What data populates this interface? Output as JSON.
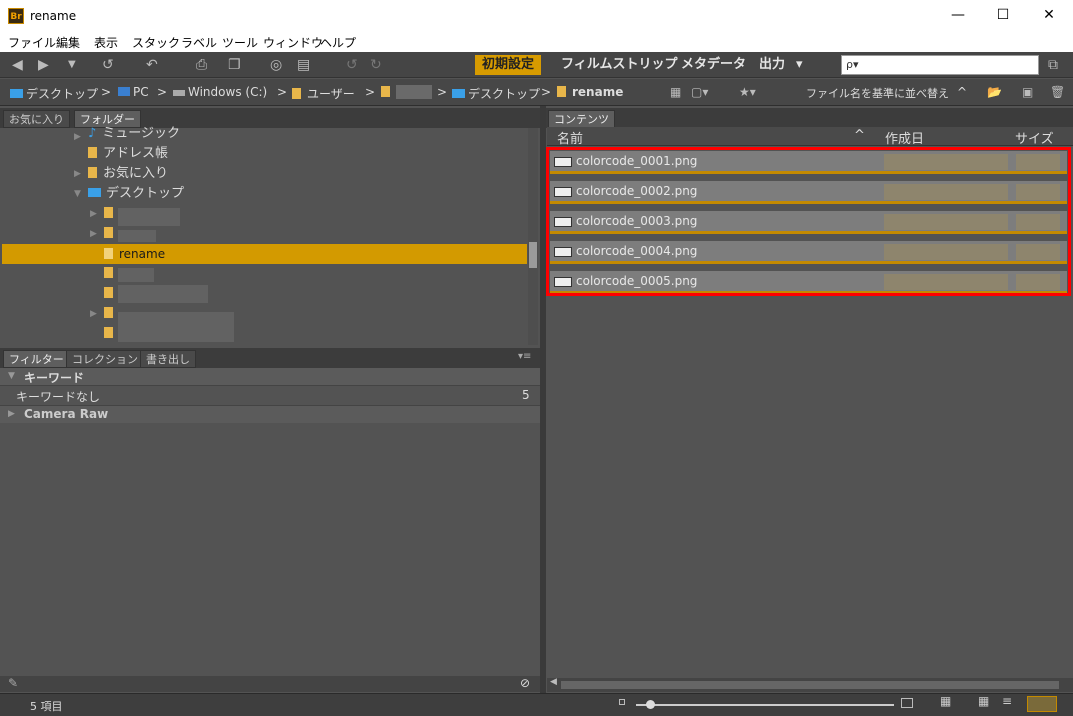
{
  "window": {
    "app_icon": "Br",
    "title": "rename",
    "minimize": "—",
    "maximize": "☐",
    "close": "✕"
  },
  "menu": [
    "ファイル",
    "編集",
    "表示",
    "スタック",
    "ラベル",
    "ツール",
    "ウィンドウ",
    "ヘルプ"
  ],
  "workspaces": {
    "active": "初期設定",
    "items": [
      "フィルムストリップ",
      "メタデータ",
      "出力"
    ],
    "more": "▾"
  },
  "search": {
    "placeholder": "ρ▾"
  },
  "path": {
    "items": [
      "デスクトップ",
      "PC",
      "Windows (C:)",
      "ユーザー",
      "",
      "デスクトップ",
      "rename"
    ],
    "separator": ">",
    "sort_label": "ファイル名を基準に並べ替え",
    "sort_dir": "^"
  },
  "left_tabs": {
    "favorites": "お気に入り",
    "folders": "フォルダー"
  },
  "tree": [
    {
      "label": "ミュージック"
    },
    {
      "label": "アドレス帳"
    },
    {
      "label": "お気に入り"
    },
    {
      "label": "デスクトップ"
    },
    {
      "label": ""
    },
    {
      "label": ""
    },
    {
      "label": "rename"
    },
    {
      "label": ""
    },
    {
      "label": ""
    },
    {
      "label": ""
    },
    {
      "label": ""
    }
  ],
  "filter_tabs": {
    "filter": "フィルター",
    "collection": "コレクション",
    "export": "書き出し",
    "menu": "▾≡"
  },
  "filter": {
    "keyword_header": "キーワード",
    "keyword_none": "キーワードなし",
    "keyword_count": "5",
    "camera_raw": "Camera Raw"
  },
  "content": {
    "tab": "コンテンツ",
    "columns": {
      "name": "名前",
      "sort": "^",
      "date": "作成日",
      "size": "サイズ"
    },
    "files": [
      "colorcode_0001.png",
      "colorcode_0002.png",
      "colorcode_0003.png",
      "colorcode_0004.png",
      "colorcode_0005.png"
    ],
    "highlight_color": "#ff0000"
  },
  "status": {
    "count": "5 項目"
  }
}
